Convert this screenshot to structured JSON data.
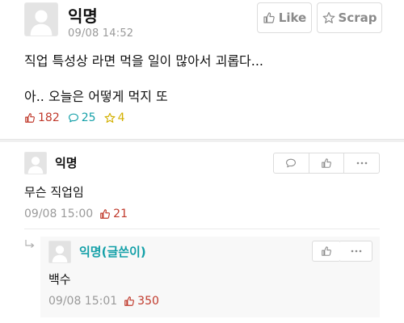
{
  "post": {
    "author": "익명",
    "time": "09/08 14:52",
    "like_label": "Like",
    "scrap_label": "Scrap",
    "line1": "직업 특성상 라면 먹을 일이 많아서 괴롭다...",
    "line2": "아.. 오늘은 어떻게 먹지 또",
    "stats": {
      "likes": "182",
      "comments": "25",
      "scraps": "4"
    }
  },
  "comment": {
    "author": "익명",
    "body": "무슨 직업임",
    "time": "09/08 15:00",
    "votes": "21"
  },
  "reply": {
    "author": "익명(글쓴이)",
    "body": "백수",
    "time": "09/08 15:01",
    "votes": "350"
  },
  "colors": {
    "like": "#c0392b",
    "comment": "#14a0a8",
    "scrap": "#d3b000",
    "writer": "#14a0a8",
    "muted": "#9a9a9a"
  },
  "icons": [
    "avatar-placeholder",
    "thumb-up-icon",
    "star-icon",
    "speech-bubble-icon",
    "more-dots-icon",
    "reply-arrow-icon"
  ]
}
